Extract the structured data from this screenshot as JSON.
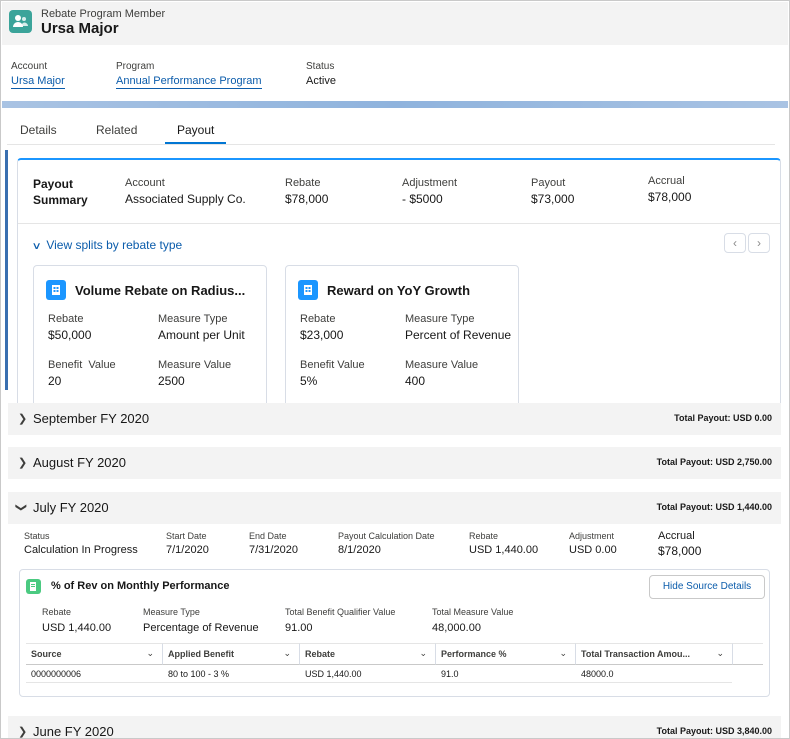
{
  "header": {
    "subtitle": "Rebate Program Member",
    "title": "Ursa Major",
    "icon": "member-icon",
    "fields": [
      {
        "label": "Account",
        "value": "Ursa Major"
      },
      {
        "label": "Program",
        "value": "Annual Performance Program"
      },
      {
        "label": "Status",
        "value": "Active"
      }
    ]
  },
  "tabs": [
    {
      "label": "Details"
    },
    {
      "label": "Related"
    },
    {
      "label": "Payout"
    }
  ],
  "active_tab": "Payout",
  "payout_summary": {
    "title_line1": "Payout",
    "title_line2": "Summary",
    "items": [
      {
        "label": "Account",
        "value": "Associated Supply Co."
      },
      {
        "label": "Rebate",
        "value": "$78,000"
      },
      {
        "label": "Adjustment",
        "value": "- $5000"
      },
      {
        "label": "Payout",
        "value": "$73,000"
      },
      {
        "label": "Accrual",
        "value": "$78,000"
      }
    ],
    "splits_link": "View splits by rebate type",
    "prev_icon": "chevron-left-icon",
    "next_icon": "chevron-right-icon",
    "cards": [
      {
        "title": "Volume Rebate on Radius...",
        "rebate_label": "Rebate",
        "rebate_value": "$50,000",
        "measure_type_label": "Measure Type",
        "measure_type_value": "Amount per Unit",
        "benefit_label": "Benefit  Value",
        "benefit_value": "20",
        "measure_value_label": "Measure Value",
        "measure_value_value": "2500"
      },
      {
        "title": "Reward on YoY Growth",
        "rebate_label": "Rebate",
        "rebate_value": "$23,000",
        "measure_type_label": "Measure Type",
        "measure_type_value": "Percent of Revenue",
        "benefit_label": "Benefit Value",
        "benefit_value": "5%",
        "measure_value_label": "Measure Value",
        "measure_value_value": "400"
      }
    ]
  },
  "months": [
    {
      "name": "September FY 2020",
      "total": "Total Payout: USD 0.00",
      "expanded": false
    },
    {
      "name": "August FY 2020",
      "total": "Total Payout: USD 2,750.00",
      "expanded": false
    },
    {
      "name": "July FY 2020",
      "total": "Total Payout: USD 1,440.00",
      "expanded": true
    },
    {
      "name": "June FY 2020",
      "total": "Total Payout: USD 3,840.00",
      "expanded": false
    }
  ],
  "july_details": [
    {
      "label": "Status",
      "value": "Calculation In Progress"
    },
    {
      "label": "Start Date",
      "value": "7/1/2020"
    },
    {
      "label": "End Date",
      "value": "7/31/2020"
    },
    {
      "label": "Payout Calculation Date",
      "value": "8/1/2020"
    },
    {
      "label": "Rebate",
      "value": "USD 1,440.00"
    },
    {
      "label": "Adjustment",
      "value": "USD 0.00"
    },
    {
      "label": "Accrual",
      "value": "$78,000"
    }
  ],
  "source_card": {
    "title": "% of Rev on Monthly Performance",
    "button": "Hide Source Details",
    "fields": [
      {
        "label": "Rebate",
        "value": "USD 1,440.00"
      },
      {
        "label": "Measure Type",
        "value": "Percentage of Revenue"
      },
      {
        "label": "Total Benefit Qualifier Value",
        "value": "91.00"
      },
      {
        "label": "Total Measure Value",
        "value": "48,000.00"
      }
    ],
    "columns": [
      "Source",
      "Applied Benefit",
      "Rebate",
      "Performance %",
      "Total Transaction Amou..."
    ],
    "rows": [
      [
        "0000000006",
        "80 to 100 - 3 %",
        "USD 1,440.00",
        "91.0",
        "48000.0"
      ]
    ]
  },
  "colors": {
    "brand": "#0176d3",
    "link": "#0b5cab",
    "header_icon": "#3ba49a",
    "source_icon": "#4bca81"
  }
}
